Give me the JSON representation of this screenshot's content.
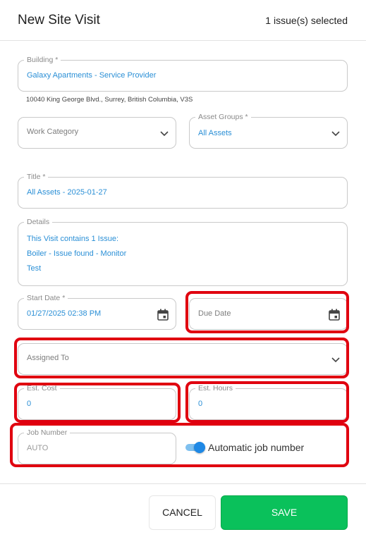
{
  "header": {
    "title": "New Site Visit",
    "selected": "1 issue(s) selected"
  },
  "building": {
    "label": "Building *",
    "value": "Galaxy Apartments - Service Provider",
    "address": "10040 King George Blvd., Surrey, British Columbia, V3S"
  },
  "work_category": {
    "placeholder": "Work Category"
  },
  "asset_groups": {
    "label": "Asset Groups *",
    "value": "All Assets"
  },
  "title_field": {
    "label": "Title *",
    "value": "All Assets - 2025-01-27"
  },
  "details": {
    "label": "Details",
    "lines": [
      "This Visit contains 1 Issue:",
      "Boiler - Issue found - Monitor",
      "Test"
    ]
  },
  "start_date": {
    "label": "Start Date *",
    "value": "01/27/2025 02:38 PM"
  },
  "due_date": {
    "placeholder": "Due Date"
  },
  "assigned_to": {
    "placeholder": "Assigned To"
  },
  "est_cost": {
    "label": "Est. Cost",
    "value": "0"
  },
  "est_hours": {
    "label": "Est. Hours",
    "value": "0"
  },
  "job_number": {
    "label": "Job Number",
    "value": "AUTO"
  },
  "auto_job": {
    "label": "Automatic job number",
    "enabled": true
  },
  "footer": {
    "cancel": "CANCEL",
    "save": "SAVE"
  },
  "colors": {
    "accent": "#2a8fd6",
    "save": "#0ac15b",
    "highlight": "#e0000f",
    "toggle": "#1e88e5"
  }
}
